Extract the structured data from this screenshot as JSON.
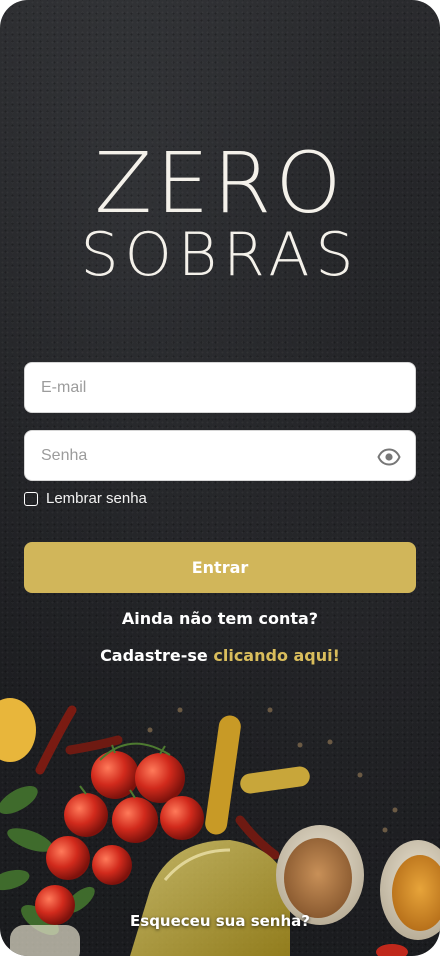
{
  "logo": {
    "line1": "ZERO",
    "line2": "SOBRAS"
  },
  "login_form": {
    "email_placeholder": "E-mail",
    "password_placeholder": "Senha",
    "remember_label": "Lembrar senha",
    "submit_label": "Entrar"
  },
  "signup": {
    "question": "Ainda não tem conta?",
    "prefix": "Cadastre-se ",
    "link_label": "clicando aqui!"
  },
  "forgot_password": "Esqueceu sua senha?",
  "colors": {
    "accent": "#d1b65a",
    "link": "#d9bd5c",
    "background": "#1f2023"
  },
  "icons": {
    "password_toggle": "eye-icon"
  }
}
